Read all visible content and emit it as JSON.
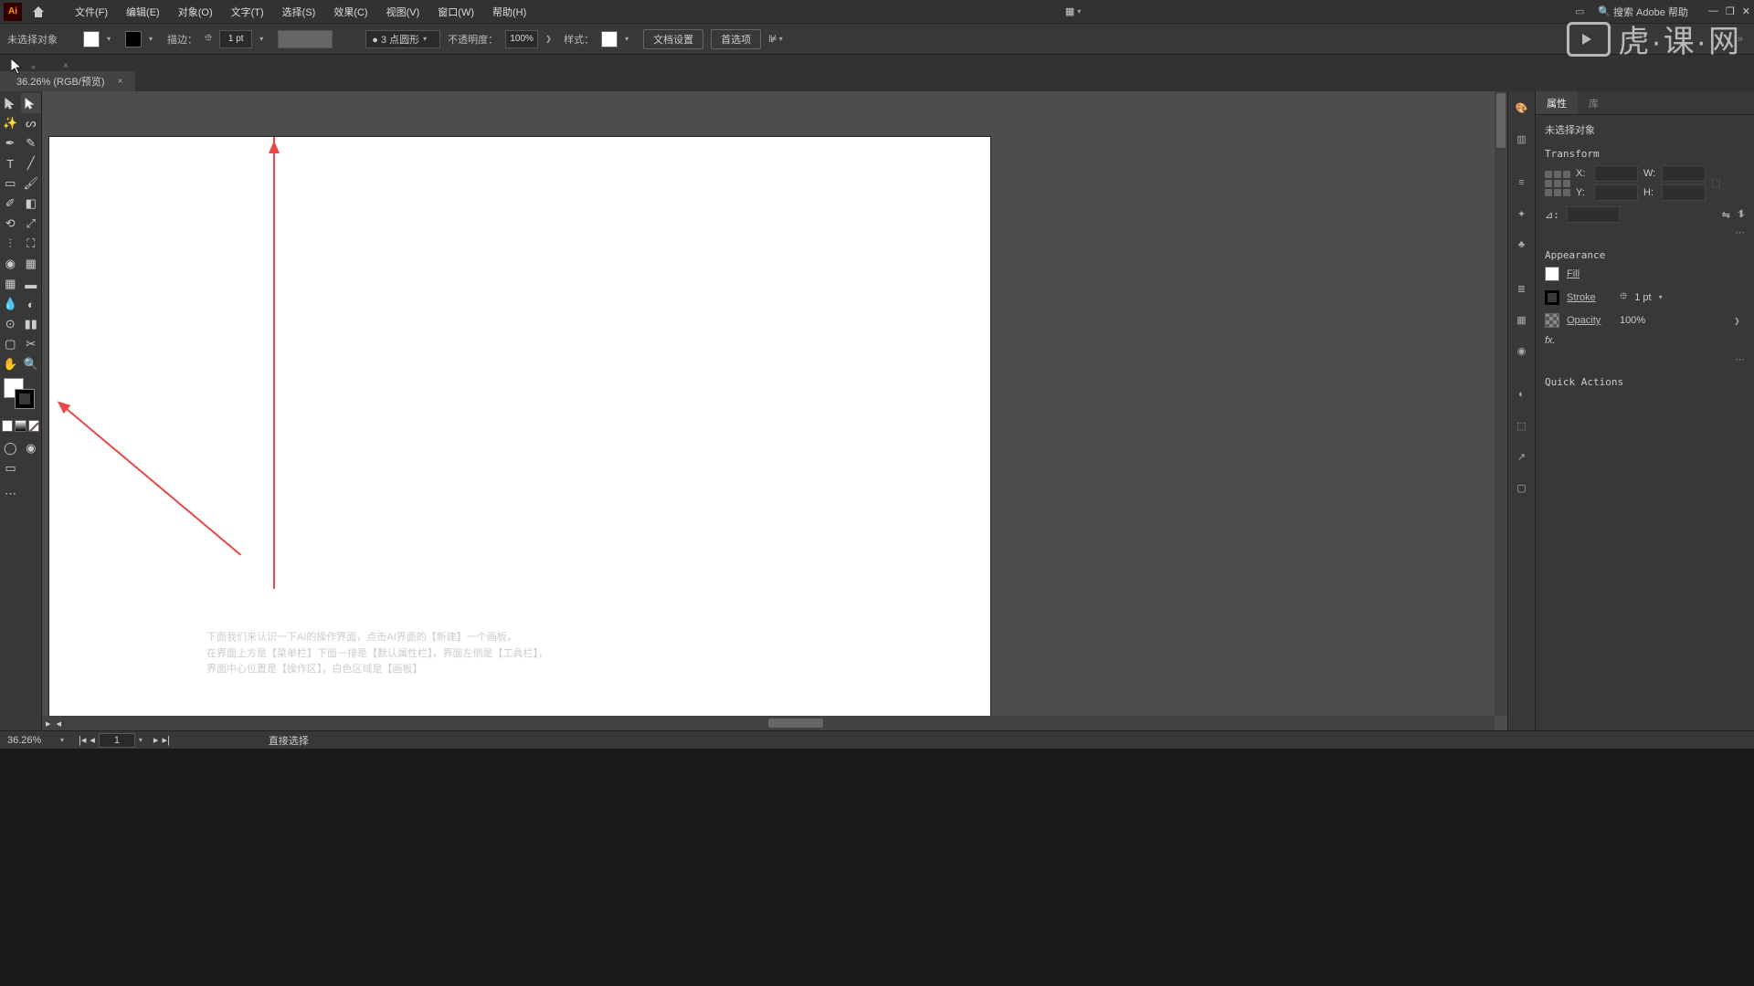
{
  "menubar": {
    "items": [
      "文件(F)",
      "编辑(E)",
      "对象(O)",
      "文字(T)",
      "选择(S)",
      "效果(C)",
      "视图(V)",
      "窗口(W)",
      "帮助(H)"
    ],
    "search_placeholder": "搜索 Adobe 帮助"
  },
  "optbar": {
    "noselection": "未选择对象",
    "stroke_label": "描边：",
    "stroke_val": "1 pt",
    "brush_shape": "● 3 点圆形",
    "opacity_label": "不透明度：",
    "opacity_val": "100%",
    "style_label": "样式：",
    "doc_setup": "文档设置",
    "prefs": "首选项"
  },
  "doctab": {
    "title": "36.26% (RGB/预览)"
  },
  "annotation": {
    "line1": "下面我们来认识一下AI的操作界面，点击AI界面的【新建】一个画板，",
    "line2": "在界面上方是【菜单栏】下面一排是【默认属性栏】，界面左侧是【工具栏】，",
    "line3": "界面中心位置是【操作区】，白色区域是【画板】"
  },
  "panels": {
    "tabs": [
      "属性",
      "库"
    ],
    "noselection": "未选择对象",
    "transform_title": "Transform",
    "x_label": "X:",
    "y_label": "Y:",
    "w_label": "W:",
    "h_label": "H:",
    "angle_label": "⊿:",
    "appearance_title": "Appearance",
    "fill_label": "Fill",
    "stroke_label": "Stroke",
    "stroke_val": "1 pt",
    "opacity_label": "Opacity",
    "opacity_val": "100%",
    "fx_label": "fx.",
    "quick_actions": "Quick Actions"
  },
  "status": {
    "zoom": "36.26%",
    "artboard": "1",
    "tool": "直接选择"
  },
  "watermark": "虎·课·网"
}
